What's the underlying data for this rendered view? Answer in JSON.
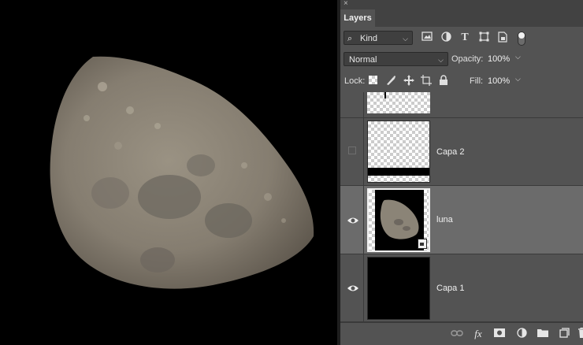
{
  "panel": {
    "close_glyph": "×",
    "tab_label": "Layers",
    "filter": {
      "value": "Kind",
      "chevron": "⌵"
    },
    "filter_icons": [
      "image-filter-icon",
      "adjustment-filter-icon",
      "type-filter-icon",
      "shape-filter-icon",
      "smart-object-filter-icon",
      "filter-toggle-icon"
    ],
    "blend_mode": "Normal",
    "opacity_label": "Opacity:",
    "opacity_value": "100%",
    "lock_label": "Lock:",
    "fill_label": "Fill:",
    "fill_value": "100%",
    "lock_icons": [
      "lock-transparent-icon",
      "lock-image-icon",
      "lock-position-icon",
      "artboard-lock-icon",
      "lock-all-icon"
    ]
  },
  "layers": [
    {
      "name": "",
      "visible": null,
      "selected": false
    },
    {
      "name": "Capa 2",
      "visible": false,
      "selected": false
    },
    {
      "name": "luna",
      "visible": true,
      "selected": true
    },
    {
      "name": "Capa 1",
      "visible": true,
      "selected": false
    }
  ],
  "bottom_icons": [
    "link-layers-icon",
    "fx-icon",
    "add-mask-icon",
    "new-adjustment-icon",
    "new-group-icon",
    "new-layer-icon",
    "delete-layer-icon"
  ],
  "colors": {
    "panel_bg": "#535353",
    "selected_row": "#6b6b6b",
    "canvas_bg": "#000000"
  }
}
